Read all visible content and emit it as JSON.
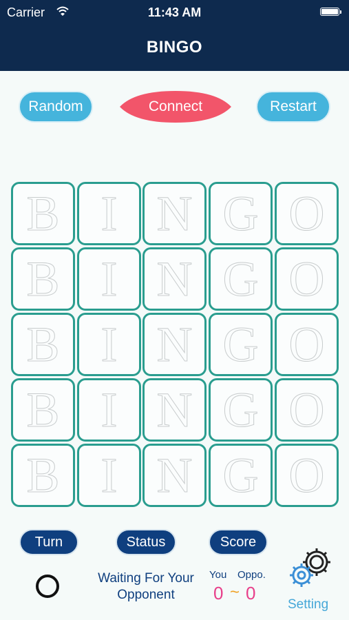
{
  "status_bar": {
    "carrier": "Carrier",
    "time": "11:43 AM"
  },
  "nav": {
    "title": "BINGO"
  },
  "actions": {
    "random": "Random",
    "connect": "Connect",
    "restart": "Restart"
  },
  "board": {
    "rows": [
      [
        "B",
        "I",
        "N",
        "G",
        "O"
      ],
      [
        "B",
        "I",
        "N",
        "G",
        "O"
      ],
      [
        "B",
        "I",
        "N",
        "G",
        "O"
      ],
      [
        "B",
        "I",
        "N",
        "G",
        "O"
      ],
      [
        "B",
        "I",
        "N",
        "G",
        "O"
      ]
    ]
  },
  "footer": {
    "turn_label": "Turn",
    "status_label": "Status",
    "score_label": "Score",
    "status_line1": "Waiting For Your",
    "status_line2": "Opponent",
    "you_label": "You",
    "oppo_label": "Oppo.",
    "you_score": "0",
    "separator": "~",
    "oppo_score": "0",
    "setting_label": "Setting"
  },
  "colors": {
    "header": "#0e2a4e",
    "button_blue": "#45b4dc",
    "connect_red": "#f2556a",
    "cell_border": "#2a9d8f",
    "pill_navy": "#0f3f7f",
    "score_pink": "#e83f8a"
  },
  "icons": [
    "wifi-icon",
    "battery-icon",
    "turn-circle-icon",
    "gear-icon"
  ]
}
